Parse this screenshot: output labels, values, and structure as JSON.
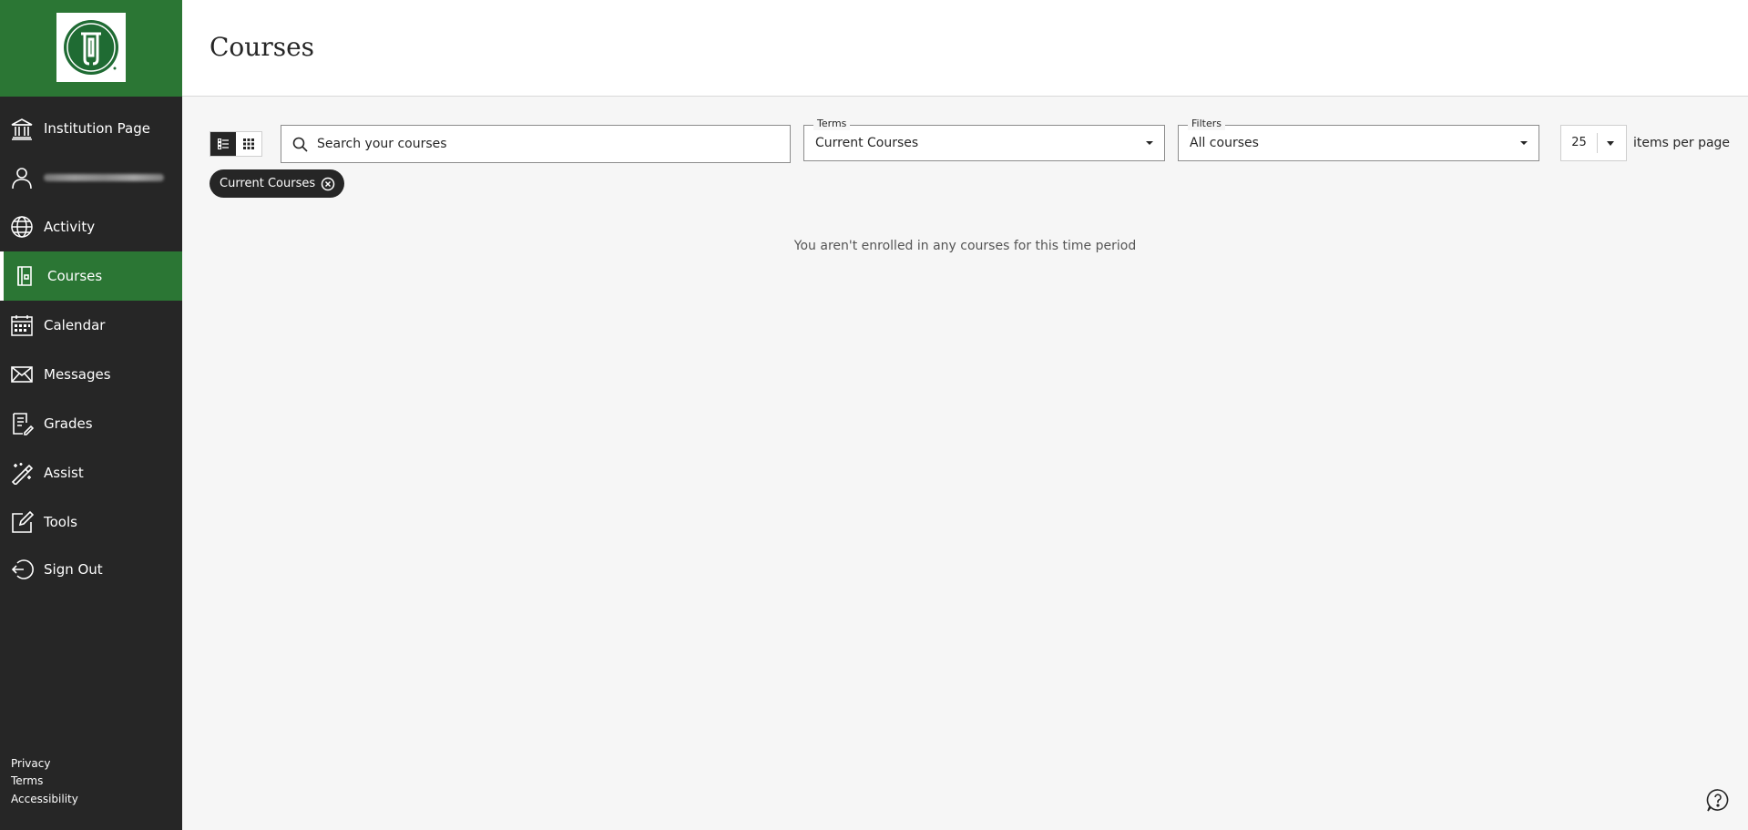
{
  "sidebar": {
    "logo_alt": "institution-logo",
    "items": [
      {
        "label": "Institution Page",
        "icon": "institution-icon"
      },
      {
        "label": "",
        "icon": "user-icon"
      },
      {
        "label": "Activity",
        "icon": "globe-icon"
      },
      {
        "label": "Courses",
        "icon": "courses-icon"
      },
      {
        "label": "Calendar",
        "icon": "calendar-icon"
      },
      {
        "label": "Messages",
        "icon": "envelope-icon"
      },
      {
        "label": "Grades",
        "icon": "grades-icon"
      },
      {
        "label": "Assist",
        "icon": "assist-icon"
      },
      {
        "label": "Tools",
        "icon": "tools-icon"
      },
      {
        "label": "Sign Out",
        "icon": "sign-out-icon"
      }
    ],
    "footer": {
      "privacy": "Privacy",
      "terms": "Terms",
      "accessibility": "Accessibility"
    }
  },
  "header": {
    "title": "Courses"
  },
  "toolbar": {
    "search_placeholder": "Search your courses",
    "terms_legend": "Terms",
    "terms_value": "Current Courses",
    "filters_legend": "Filters",
    "filters_value": "All courses",
    "items_per_page": "25",
    "items_per_page_label": "items per page"
  },
  "chip": {
    "label": "Current Courses"
  },
  "empty_message": "You aren't enrolled in any courses for this time period",
  "colors": {
    "brand_green": "#2b7634",
    "sidebar_bg": "#262626",
    "page_bg": "#f6f6f6"
  }
}
